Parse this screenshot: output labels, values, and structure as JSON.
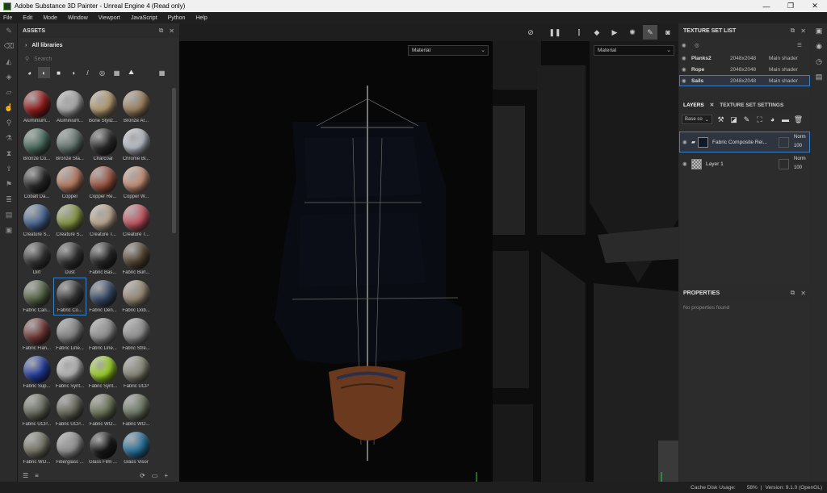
{
  "window": {
    "title": "Adobe Substance 3D Painter - Unreal Engine 4 (Read only)",
    "min": "—",
    "max": "❐",
    "close": "✕"
  },
  "menu": [
    "File",
    "Edit",
    "Mode",
    "Window",
    "Viewport",
    "JavaScript",
    "Python",
    "Help"
  ],
  "assets": {
    "title": "ASSETS",
    "library": "All libraries",
    "search_placeholder": "Search",
    "items": [
      {
        "label": "Aluminium...",
        "color": "#a11d1d"
      },
      {
        "label": "Aluminium...",
        "color": "#b7b7b7"
      },
      {
        "label": "Bone Styliz...",
        "color": "#c2a77a"
      },
      {
        "label": "Bronze Ar...",
        "color": "#a88a66"
      },
      {
        "label": "Bronze Co...",
        "color": "#4e7464"
      },
      {
        "label": "Bronze Sta...",
        "color": "#6b7d76"
      },
      {
        "label": "Charcoal",
        "color": "#2f2f2f"
      },
      {
        "label": "Chrome Bl...",
        "color": "#c6ccd6"
      },
      {
        "label": "Cobalt Da...",
        "color": "#2b2b2b"
      },
      {
        "label": "Copper",
        "color": "#c58468"
      },
      {
        "label": "Copper Re...",
        "color": "#a85b46"
      },
      {
        "label": "Copper W...",
        "color": "#d59a80"
      },
      {
        "label": "Creature S...",
        "color": "#4e6f9e"
      },
      {
        "label": "Creature S...",
        "color": "#8ea047"
      },
      {
        "label": "Creature T...",
        "color": "#c9b39a"
      },
      {
        "label": "Creature T...",
        "color": "#d45c6a"
      },
      {
        "label": "Dirt",
        "color": "#3a3a3a"
      },
      {
        "label": "Dust",
        "color": "#363636"
      },
      {
        "label": "Fabric Bas...",
        "color": "#2a2a2a"
      },
      {
        "label": "Fabric Burl...",
        "color": "#5c4a36"
      },
      {
        "label": "Fabric Can...",
        "color": "#5a6a48"
      },
      {
        "label": "Fabric Co...",
        "color": "#3c3c3c"
      },
      {
        "label": "Fabric Den...",
        "color": "#3a4f6e"
      },
      {
        "label": "Fabric Dob...",
        "color": "#a2917c"
      },
      {
        "label": "Fabric Flan...",
        "color": "#7a3b3b"
      },
      {
        "label": "Fabric Line...",
        "color": "#8a8a8a"
      },
      {
        "label": "Fabric Line...",
        "color": "#9a9a9a"
      },
      {
        "label": "Fabric Stre...",
        "color": "#9a9a9a"
      },
      {
        "label": "Fabric Sup...",
        "color": "#2540a8"
      },
      {
        "label": "Fabric Synt...",
        "color": "#c2c2c2"
      },
      {
        "label": "Fabric Synt...",
        "color": "#a6e02a"
      },
      {
        "label": "Fabric UCP",
        "color": "#8f8f7e"
      },
      {
        "label": "Fabric UCP...",
        "color": "#6e7264"
      },
      {
        "label": "Fabric UCP...",
        "color": "#6c6c60"
      },
      {
        "label": "Fabric WO...",
        "color": "#6f7a5a"
      },
      {
        "label": "Fabric WO...",
        "color": "#74806a"
      },
      {
        "label": "Fabric WO...",
        "color": "#7c7c6c"
      },
      {
        "label": "Fiberglass ...",
        "color": "#9a9a9a"
      },
      {
        "label": "Glass Film ...",
        "color": "#1a1a1a"
      },
      {
        "label": "Glass Visor",
        "color": "#2a7aa8"
      }
    ]
  },
  "viewport": {
    "left_dropdown": "Material",
    "right_dropdown": "Material"
  },
  "texture_sets": {
    "title": "TEXTURE SET LIST",
    "rows": [
      {
        "name": "Planks2",
        "res": "2048x2048",
        "shader": "Main shader"
      },
      {
        "name": "Rope",
        "res": "2048x2048",
        "shader": "Main shader"
      },
      {
        "name": "Sails",
        "res": "2048x2048",
        "shader": "Main shader"
      }
    ]
  },
  "layers": {
    "tab_layers": "LAYERS",
    "tab_settings": "TEXTURE SET SETTINGS",
    "channel": "Base co",
    "items": [
      {
        "name": "Fabric Composite Rei...",
        "blend": "Norm",
        "opacity": "100"
      },
      {
        "name": "Layer 1",
        "blend": "Norm",
        "opacity": "100"
      }
    ]
  },
  "properties": {
    "title": "PROPERTIES",
    "empty": "No properties found"
  },
  "status": {
    "label": "Cache Disk Usage:",
    "usage": "58%",
    "sep": "|",
    "version": "Version: 9.1.0 (OpenGL)"
  }
}
